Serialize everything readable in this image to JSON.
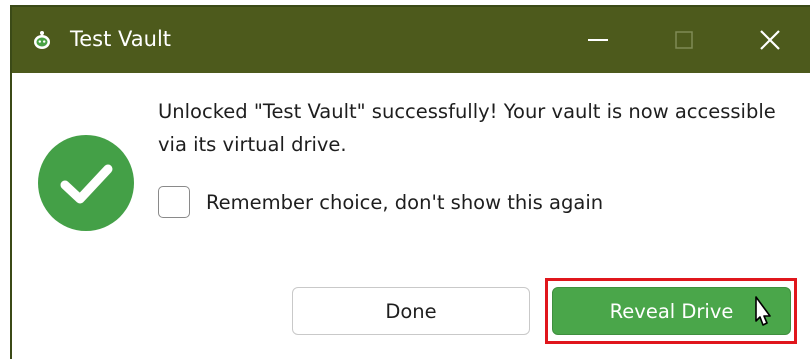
{
  "window": {
    "title": "Test Vault"
  },
  "dialog": {
    "message": "Unlocked \"Test Vault\" successfully! Your vault is now accessible via its virtual drive.",
    "remember_label": "Remember choice, don't show this again",
    "remember_checked": false
  },
  "buttons": {
    "done_label": "Done",
    "reveal_label": "Reveal Drive"
  },
  "colors": {
    "titlebar": "#4d5a1c",
    "success": "#44a047",
    "primary_button": "#4aa64a",
    "highlight": "#e0161c"
  },
  "icons": {
    "app": "cryptomator-bot-icon",
    "success": "checkmark-circle-icon",
    "minimize": "minimize-icon",
    "maximize": "maximize-icon",
    "close": "close-icon",
    "cursor": "mouse-pointer-icon"
  }
}
